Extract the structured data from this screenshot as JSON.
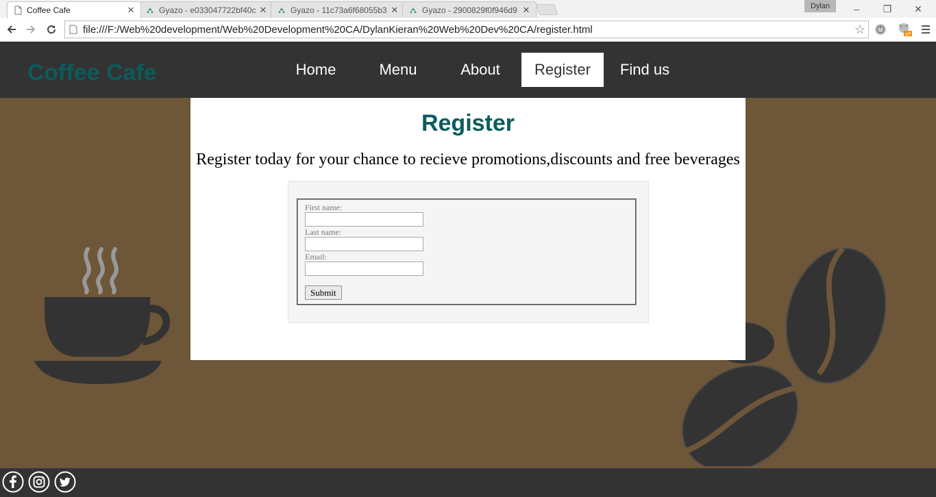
{
  "browser": {
    "tabs": [
      {
        "title": "Coffee Cafe",
        "active": true
      },
      {
        "title": "Gyazo - e033047722bf40c",
        "active": false
      },
      {
        "title": "Gyazo - 11c73a6f68055b3",
        "active": false
      },
      {
        "title": "Gyazo - 2900829f0f946d9",
        "active": false
      }
    ],
    "profile_name": "Dylan",
    "url": "file:///F:/Web%20development/Web%20Development%20CA/DylanKieran%20Web%20Dev%20CA/register.html",
    "extension_badge": "off"
  },
  "site": {
    "logo": "Coffee Cafe",
    "nav": [
      "Home",
      "Menu",
      "About",
      "Register",
      "Find us"
    ],
    "active_nav": "Register",
    "heading": "Register",
    "intro": "Register today for your chance to recieve promotions,discounts and free beverages",
    "form": {
      "first_name_label": "First name:",
      "first_name_value": "",
      "last_name_label": "Last name:",
      "last_name_value": "",
      "email_label": "Email:",
      "email_value": "",
      "submit_label": "Submit"
    },
    "colors": {
      "header_bg": "#333333",
      "page_bg": "#6e5638",
      "accent": "#0c5c5c"
    },
    "footer_icons": [
      "facebook-icon",
      "instagram-icon",
      "twitter-icon"
    ]
  }
}
